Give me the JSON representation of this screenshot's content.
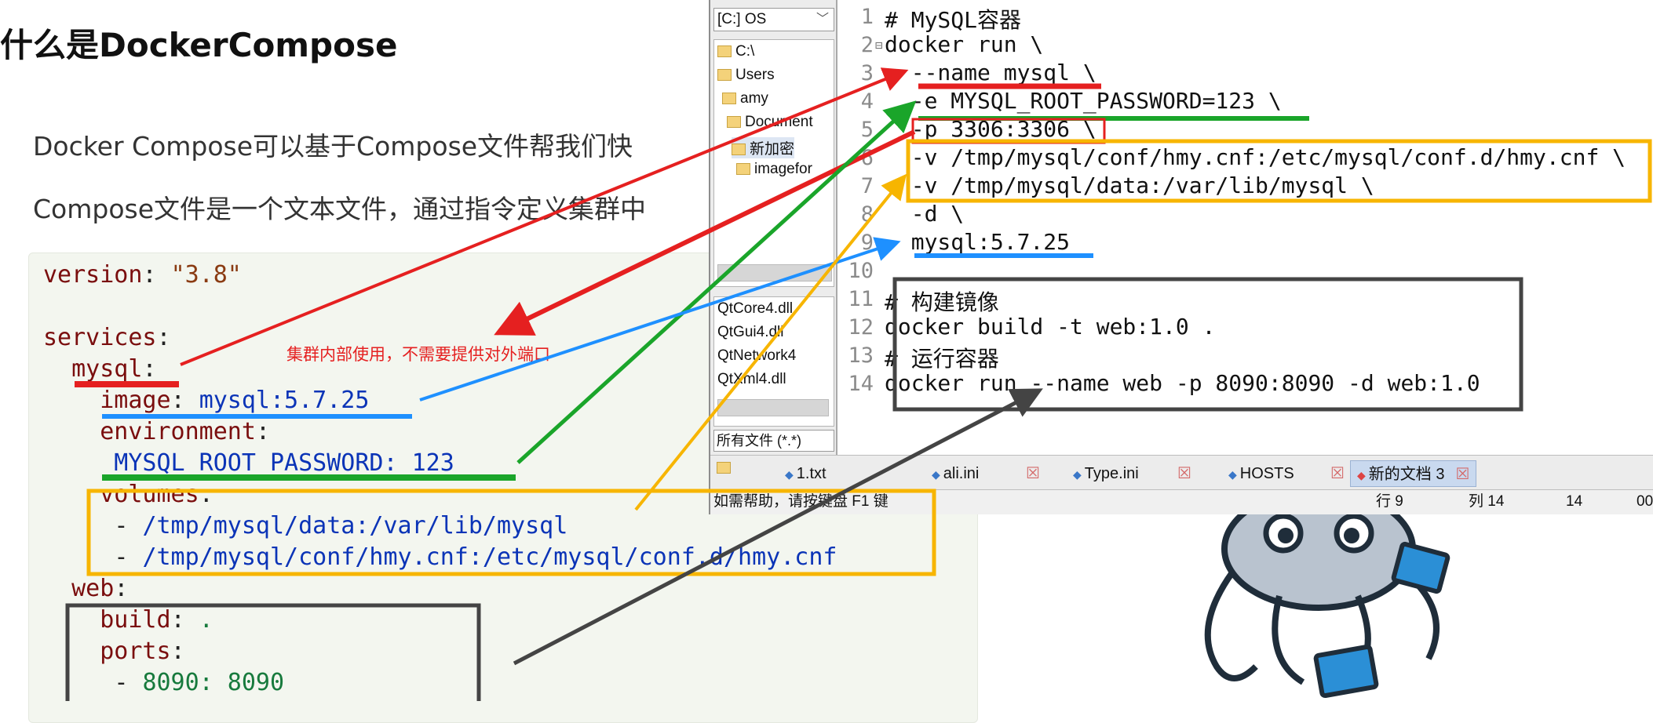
{
  "slide": {
    "title": "什么是DockerCompose",
    "line1": "Docker Compose可以基于Compose文件帮我们快",
    "line2": "Compose文件是一个文本文件，通过指令定义集群中"
  },
  "yaml": {
    "lines": [
      {
        "k": "version",
        "sep": ": ",
        "v": "\"3.8\""
      },
      {
        "k": "services",
        "sep": ":",
        "v": ""
      },
      {
        "k": "  mysql",
        "sep": ":",
        "v": ""
      },
      {
        "k": "    image",
        "sep": ": ",
        "v": "mysql:5.7.25"
      },
      {
        "k": "    environment",
        "sep": ":",
        "v": ""
      },
      {
        "k": "",
        "sep": "",
        "v": "     MYSQL_ROOT_PASSWORD: 123"
      },
      {
        "k": "    volumes",
        "sep": ":",
        "v": ""
      },
      {
        "k": "",
        "sep": "",
        "v": "/tmp/mysql/data:/var/lib/mysql"
      },
      {
        "k": "",
        "sep": "",
        "v": "/tmp/mysql/conf/hmy.cnf:/etc/mysql/conf.d/hmy.cnf"
      },
      {
        "k": "  web",
        "sep": ":",
        "v": ""
      },
      {
        "k": "    build",
        "sep": ": ",
        "v": "."
      },
      {
        "k": "    ports",
        "sep": ":",
        "v": ""
      },
      {
        "k": "",
        "sep": "",
        "v": "8090: 8090"
      }
    ],
    "dash": "-"
  },
  "note": "集群内部使用，不需要提供对外端口",
  "explorer": {
    "drive": "[C:] OS",
    "tree": [
      "C:\\",
      "Users",
      "amy",
      "Document",
      "新加密",
      "imagefor"
    ],
    "files": [
      "QtCore4.dll",
      "QtGui4.dll",
      "QtNetwork4",
      "QtXml4.dll"
    ],
    "filter": "所有文件 (*.*)"
  },
  "code": {
    "lines": [
      "# MySQL容器",
      "docker run \\",
      "  --name mysql \\",
      "  -e MYSQL_ROOT_PASSWORD=123 \\",
      "  -p 3306:3306 \\",
      "  -v /tmp/mysql/conf/hmy.cnf:/etc/mysql/conf.d/hmy.cnf \\",
      "  -v /tmp/mysql/data:/var/lib/mysql \\",
      "  -d \\",
      "  mysql:5.7.25",
      "",
      "# 构建镜像",
      "docker build -t web:1.0 .",
      "# 运行容器",
      "docker run --name web -p 8090:8090 -d web:1.0"
    ],
    "line_numbers": [
      "1",
      "2",
      "3",
      "4",
      "5",
      "6",
      "7",
      "8",
      "9",
      "10",
      "11",
      "12",
      "13",
      "14"
    ]
  },
  "tabs": [
    {
      "label": "1.txt",
      "active": false
    },
    {
      "label": "ali.ini",
      "active": false
    },
    {
      "label": "Type.ini",
      "active": false
    },
    {
      "label": "HOSTS",
      "active": false
    },
    {
      "label": "新的文档 3",
      "active": true
    }
  ],
  "status": {
    "help": "如需帮助，请按键盘 F1 键",
    "row": "行 9",
    "col": "列 14",
    "num": "14",
    "extra": "00"
  },
  "colors": {
    "red": "#e52020",
    "green": "#1aa52a",
    "blue": "#1e90ff",
    "yellow": "#f7b500",
    "dark": "#444444"
  }
}
